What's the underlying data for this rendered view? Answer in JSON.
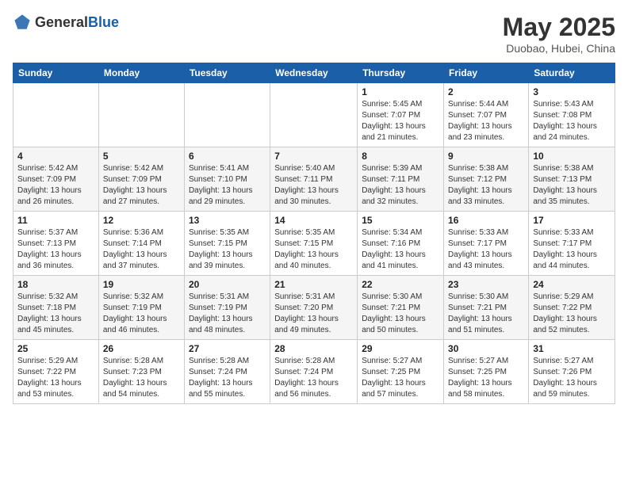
{
  "header": {
    "logo_general": "General",
    "logo_blue": "Blue",
    "month_year": "May 2025",
    "location": "Duobao, Hubei, China"
  },
  "weekdays": [
    "Sunday",
    "Monday",
    "Tuesday",
    "Wednesday",
    "Thursday",
    "Friday",
    "Saturday"
  ],
  "weeks": [
    [
      {
        "day": "",
        "info": ""
      },
      {
        "day": "",
        "info": ""
      },
      {
        "day": "",
        "info": ""
      },
      {
        "day": "",
        "info": ""
      },
      {
        "day": "1",
        "info": "Sunrise: 5:45 AM\nSunset: 7:07 PM\nDaylight: 13 hours\nand 21 minutes."
      },
      {
        "day": "2",
        "info": "Sunrise: 5:44 AM\nSunset: 7:07 PM\nDaylight: 13 hours\nand 23 minutes."
      },
      {
        "day": "3",
        "info": "Sunrise: 5:43 AM\nSunset: 7:08 PM\nDaylight: 13 hours\nand 24 minutes."
      }
    ],
    [
      {
        "day": "4",
        "info": "Sunrise: 5:42 AM\nSunset: 7:09 PM\nDaylight: 13 hours\nand 26 minutes."
      },
      {
        "day": "5",
        "info": "Sunrise: 5:42 AM\nSunset: 7:09 PM\nDaylight: 13 hours\nand 27 minutes."
      },
      {
        "day": "6",
        "info": "Sunrise: 5:41 AM\nSunset: 7:10 PM\nDaylight: 13 hours\nand 29 minutes."
      },
      {
        "day": "7",
        "info": "Sunrise: 5:40 AM\nSunset: 7:11 PM\nDaylight: 13 hours\nand 30 minutes."
      },
      {
        "day": "8",
        "info": "Sunrise: 5:39 AM\nSunset: 7:11 PM\nDaylight: 13 hours\nand 32 minutes."
      },
      {
        "day": "9",
        "info": "Sunrise: 5:38 AM\nSunset: 7:12 PM\nDaylight: 13 hours\nand 33 minutes."
      },
      {
        "day": "10",
        "info": "Sunrise: 5:38 AM\nSunset: 7:13 PM\nDaylight: 13 hours\nand 35 minutes."
      }
    ],
    [
      {
        "day": "11",
        "info": "Sunrise: 5:37 AM\nSunset: 7:13 PM\nDaylight: 13 hours\nand 36 minutes."
      },
      {
        "day": "12",
        "info": "Sunrise: 5:36 AM\nSunset: 7:14 PM\nDaylight: 13 hours\nand 37 minutes."
      },
      {
        "day": "13",
        "info": "Sunrise: 5:35 AM\nSunset: 7:15 PM\nDaylight: 13 hours\nand 39 minutes."
      },
      {
        "day": "14",
        "info": "Sunrise: 5:35 AM\nSunset: 7:15 PM\nDaylight: 13 hours\nand 40 minutes."
      },
      {
        "day": "15",
        "info": "Sunrise: 5:34 AM\nSunset: 7:16 PM\nDaylight: 13 hours\nand 41 minutes."
      },
      {
        "day": "16",
        "info": "Sunrise: 5:33 AM\nSunset: 7:17 PM\nDaylight: 13 hours\nand 43 minutes."
      },
      {
        "day": "17",
        "info": "Sunrise: 5:33 AM\nSunset: 7:17 PM\nDaylight: 13 hours\nand 44 minutes."
      }
    ],
    [
      {
        "day": "18",
        "info": "Sunrise: 5:32 AM\nSunset: 7:18 PM\nDaylight: 13 hours\nand 45 minutes."
      },
      {
        "day": "19",
        "info": "Sunrise: 5:32 AM\nSunset: 7:19 PM\nDaylight: 13 hours\nand 46 minutes."
      },
      {
        "day": "20",
        "info": "Sunrise: 5:31 AM\nSunset: 7:19 PM\nDaylight: 13 hours\nand 48 minutes."
      },
      {
        "day": "21",
        "info": "Sunrise: 5:31 AM\nSunset: 7:20 PM\nDaylight: 13 hours\nand 49 minutes."
      },
      {
        "day": "22",
        "info": "Sunrise: 5:30 AM\nSunset: 7:21 PM\nDaylight: 13 hours\nand 50 minutes."
      },
      {
        "day": "23",
        "info": "Sunrise: 5:30 AM\nSunset: 7:21 PM\nDaylight: 13 hours\nand 51 minutes."
      },
      {
        "day": "24",
        "info": "Sunrise: 5:29 AM\nSunset: 7:22 PM\nDaylight: 13 hours\nand 52 minutes."
      }
    ],
    [
      {
        "day": "25",
        "info": "Sunrise: 5:29 AM\nSunset: 7:22 PM\nDaylight: 13 hours\nand 53 minutes."
      },
      {
        "day": "26",
        "info": "Sunrise: 5:28 AM\nSunset: 7:23 PM\nDaylight: 13 hours\nand 54 minutes."
      },
      {
        "day": "27",
        "info": "Sunrise: 5:28 AM\nSunset: 7:24 PM\nDaylight: 13 hours\nand 55 minutes."
      },
      {
        "day": "28",
        "info": "Sunrise: 5:28 AM\nSunset: 7:24 PM\nDaylight: 13 hours\nand 56 minutes."
      },
      {
        "day": "29",
        "info": "Sunrise: 5:27 AM\nSunset: 7:25 PM\nDaylight: 13 hours\nand 57 minutes."
      },
      {
        "day": "30",
        "info": "Sunrise: 5:27 AM\nSunset: 7:25 PM\nDaylight: 13 hours\nand 58 minutes."
      },
      {
        "day": "31",
        "info": "Sunrise: 5:27 AM\nSunset: 7:26 PM\nDaylight: 13 hours\nand 59 minutes."
      }
    ]
  ]
}
